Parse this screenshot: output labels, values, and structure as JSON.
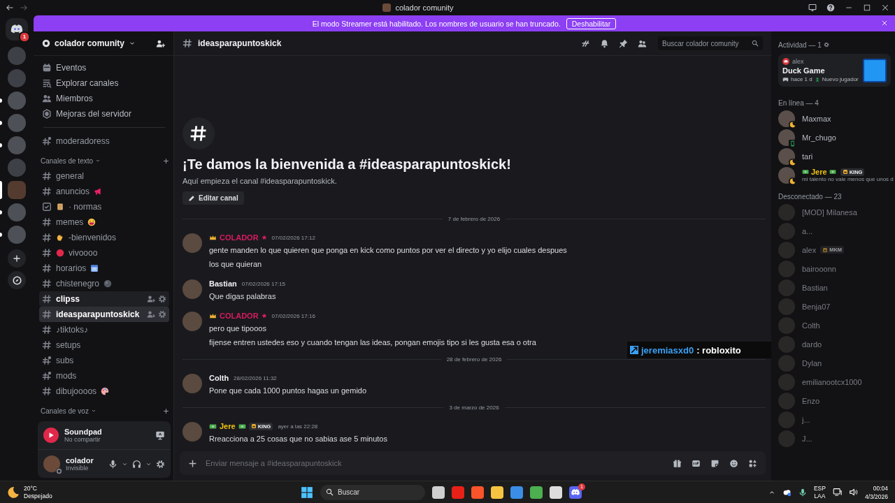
{
  "window": {
    "title": "colador comunity"
  },
  "banner": {
    "text": "El modo Streamer está habilitado. Los nombres de usuario se han truncado.",
    "button": "Deshabilitar"
  },
  "servers": {
    "badge": "1",
    "items": [
      {
        "selected": false,
        "unread": false
      },
      {
        "selected": false,
        "unread": false
      },
      {
        "selected": false,
        "unread": true
      },
      {
        "selected": false,
        "unread": true
      },
      {
        "selected": false,
        "unread": true
      },
      {
        "selected": false,
        "unread": false
      },
      {
        "selected": true,
        "unread": false
      },
      {
        "selected": false,
        "unread": true
      },
      {
        "selected": false,
        "unread": true
      }
    ]
  },
  "sidebar": {
    "server_name": "colador comunity",
    "nav": [
      {
        "kind": "events",
        "label": "Eventos"
      },
      {
        "kind": "browse",
        "label": "Explorar canales"
      },
      {
        "kind": "members",
        "label": "Miembros"
      },
      {
        "kind": "boost",
        "label": "Mejoras del servidor"
      }
    ],
    "pinned": [
      {
        "kind": "private",
        "name": "moderadoress",
        "selected": false,
        "hovered": false
      }
    ],
    "categories": [
      {
        "name": "Canales de texto",
        "channels": [
          {
            "kind": "text",
            "name": "general",
            "selected": false,
            "hovered": false
          },
          {
            "kind": "text",
            "name": "anuncios",
            "emoji_after": {
              "kind": "megaphone"
            },
            "selected": false,
            "hovered": false
          },
          {
            "kind": "rules",
            "name": "· normas",
            "emoji_before": {
              "kind": "scroll"
            },
            "selected": false,
            "hovered": false
          },
          {
            "kind": "text",
            "name": "memes",
            "emoji_after": {
              "kind": "laugh"
            },
            "selected": false,
            "hovered": false
          },
          {
            "kind": "text",
            "name": "-bienvenidos",
            "emoji_before": {
              "kind": "wave"
            },
            "selected": false,
            "hovered": false
          },
          {
            "kind": "text",
            "name": "vivoooo",
            "emoji_before": {
              "kind": "dot"
            },
            "selected": false,
            "hovered": false
          },
          {
            "kind": "text",
            "name": "horarios",
            "emoji_after": {
              "kind": "calendar"
            },
            "selected": false,
            "hovered": false
          },
          {
            "kind": "text",
            "name": "chistenegro",
            "emoji_after": {
              "kind": "ball"
            },
            "selected": false,
            "hovered": false
          },
          {
            "kind": "text",
            "name": "clipss",
            "selected": false,
            "hovered": true
          },
          {
            "kind": "text",
            "name": "ideasparapuntoskick",
            "selected": true,
            "hovered": false
          },
          {
            "kind": "text",
            "name": "♪tiktoks♪",
            "selected": false,
            "hovered": false
          },
          {
            "kind": "text",
            "name": "setups",
            "selected": false,
            "hovered": false
          },
          {
            "kind": "private",
            "name": "subs",
            "selected": false,
            "hovered": false
          },
          {
            "kind": "private",
            "name": "mods",
            "selected": false,
            "hovered": false
          },
          {
            "kind": "text",
            "name": "dibujoooos",
            "emoji_after": {
              "kind": "palette"
            },
            "selected": false,
            "hovered": false
          }
        ]
      },
      {
        "name": "Canales de voz"
      }
    ],
    "app_panel": {
      "name": "Soundpad",
      "status": "No compartir"
    },
    "user": {
      "name": "colador",
      "status": "Invisible"
    }
  },
  "chat": {
    "channel": "ideasparapuntoskick",
    "search_placeholder": "Buscar colador comunity",
    "welcome": {
      "title": "¡Te damos la bienvenida a #ideasparapuntoskick!",
      "subtitle": "Aquí empieza el canal #ideasparapuntoskick.",
      "button": "Editar canal"
    },
    "messages": [
      {
        "kind": "divider",
        "text": "7 de febrero de 2026"
      },
      {
        "kind": "message",
        "author": "COLADOR",
        "color": "#d81b60",
        "flair": {
          "kind": "crown-star"
        },
        "time": "07/02/2026 17:12",
        "lines": [
          "gente manden lo que quieren que ponga en kick como puntos por ver el directo y yo elijo cuales despues",
          "los que quieran"
        ]
      },
      {
        "kind": "message",
        "author": "Bastian",
        "time": "07/02/2026 17:15",
        "lines": [
          "Que digas palabras"
        ]
      },
      {
        "kind": "message",
        "author": "COLADOR",
        "color": "#d81b60",
        "flair": {
          "kind": "crown-star"
        },
        "time": "07/02/2026 17:16",
        "lines": [
          "pero que tipooos",
          "fijense entren ustedes eso y cuando tengan las ideas, pongan emojis tipo si les gusta esa o otra"
        ]
      },
      {
        "kind": "divider",
        "text": "28 de febrero de 2026"
      },
      {
        "kind": "message",
        "author": "Colth",
        "time": "28/02/2026 11:32",
        "lines": [
          "Pone que cada 1000 puntos hagas un gemido"
        ]
      },
      {
        "kind": "divider",
        "text": "3 de marzo de 2026"
      },
      {
        "kind": "message",
        "author": "Jere",
        "color": "#f1c40f",
        "flair": {
          "kind": "money"
        },
        "tag": "KING",
        "time": "ayer a las 22:28",
        "lines": [
          "Rreacciona a 25 cosas que no sabias ase 5 minutos"
        ]
      }
    ],
    "overlay": {
      "user": "jeremiasxd0",
      "text": ": robloxito"
    },
    "composer_placeholder": "Enviar mensaje a #ideasparapuntoskick"
  },
  "members": {
    "activity": {
      "heading": "Actividad — 1",
      "user": "alex",
      "game": "Duck Game",
      "time": "hace 1 d",
      "note": "Nuevo jugador"
    },
    "groups": [
      {
        "heading": "En línea — 4",
        "offline": false,
        "members": [
          {
            "name": "Maxmax",
            "status": {
              "kind": "idle"
            }
          },
          {
            "name": "Mr_chugo",
            "status": {
              "kind": "mobile"
            }
          },
          {
            "name": "tari",
            "status": {
              "kind": "idle"
            }
          },
          {
            "name": "Jere",
            "status": {
              "kind": "idle"
            },
            "color": "#f1c40f",
            "tag": "KING",
            "note": "mi talento no vale menos que unos d"
          }
        ]
      },
      {
        "heading": "Desconectado — 23",
        "offline": true,
        "members": [
          {
            "name": "[MOD] Milanesa"
          },
          {
            "name": "a..."
          },
          {
            "name": "alex",
            "tag": "MKM"
          },
          {
            "name": "bairooonn"
          },
          {
            "name": "Bastian"
          },
          {
            "name": "Benja07"
          },
          {
            "name": "Colth"
          },
          {
            "name": "dardo"
          },
          {
            "name": "Dylan"
          },
          {
            "name": "emilianootcx1000"
          },
          {
            "name": "Enzo"
          },
          {
            "name": "j..."
          },
          {
            "name": "J..."
          }
        ]
      }
    ]
  },
  "taskbar": {
    "temperature": "20°C",
    "weather": "Despejado",
    "search": "Buscar",
    "app_badge": "1",
    "language": "ESP",
    "layout": "LAA",
    "time": "00:04",
    "date": "4/3/2026"
  }
}
